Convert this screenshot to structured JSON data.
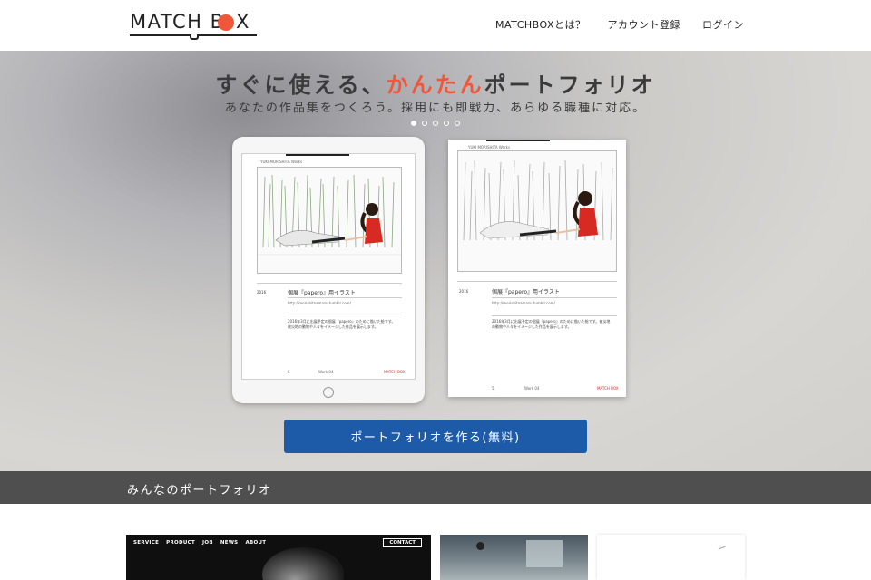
{
  "header": {
    "logo": "MATCH BOX",
    "nav": [
      {
        "label": "MATCHBOXとは？"
      },
      {
        "label": "アカウント登録"
      },
      {
        "label": "ログイン"
      }
    ]
  },
  "hero": {
    "title_prefix": "すぐに使える、",
    "title_accent": "かんたん",
    "title_suffix": "ポートフォリオ",
    "subtitle": "あなたの作品集をつくろう。採用にも即戦力、あらゆる職種に対応。",
    "carousel": {
      "count": 5,
      "active": 1
    },
    "cta_label": "ポートフォリオを作る(無料)"
  },
  "preview": {
    "tablet": {
      "header_text": "YUKI MORISHITA  Works",
      "year": "2016",
      "caption": "個展『papero』用イラスト",
      "url": "http://morishitaamazu.tumblr.com/",
      "body": "2016年3月に出展予定の個展『papero』のために描いた絵です。被災地の動物や人々をイメージした作品を展示します。",
      "page": "5",
      "footer": "Work 04",
      "brand": "MATCH BOX"
    },
    "paper": {
      "header_text": "YUKI MORISHITA  Works",
      "year": "2016",
      "caption": "個展『papero』用イラスト",
      "url": "http://morishitaamazu.tumblr.com/",
      "body": "2016年3月に出展予定の個展『papero』のために描いた絵です。被災地の動物や人々をイメージした作品を展示します。",
      "page": "5",
      "footer": "Work 04",
      "brand": "MATCH BOX"
    }
  },
  "section": {
    "title": "みんなのポートフォリオ"
  },
  "portfolios": {
    "card1": {
      "nav": [
        "SERVICE",
        "PRODUCT",
        "JOB",
        "NEWS",
        "ABOUT"
      ],
      "contact": "CONTACT"
    }
  },
  "colors": {
    "accent": "#f0563a",
    "cta": "#1d5ba8",
    "section_bar": "#373737"
  }
}
